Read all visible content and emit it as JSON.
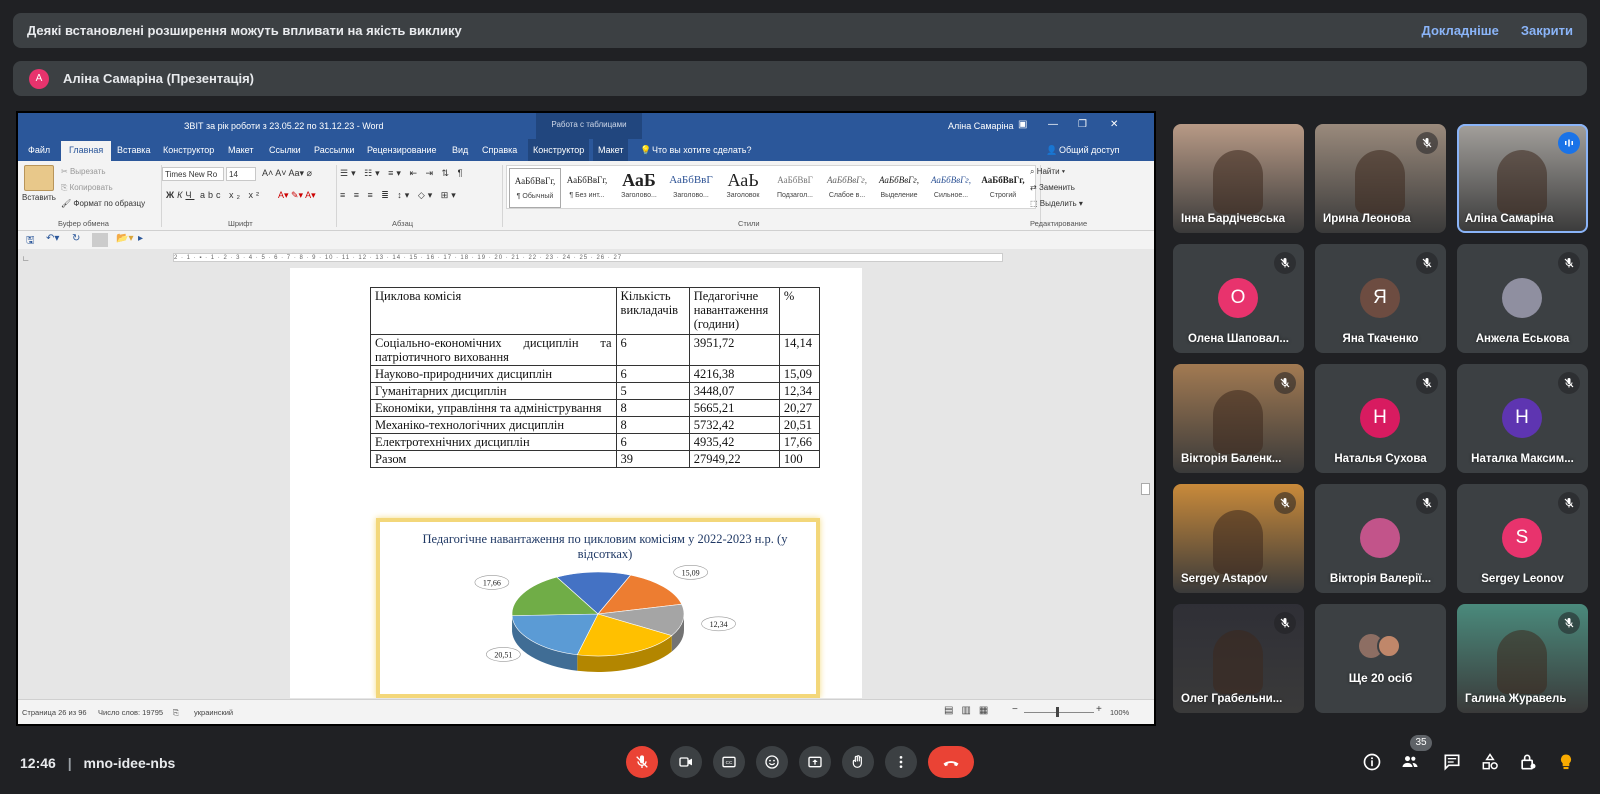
{
  "banner": {
    "text": "Деякі встановлені розширення можуть впливати на якість виклику",
    "more": "Докладніше",
    "close": "Закрити"
  },
  "presenter": {
    "initial": "A",
    "name": "Аліна Самаріна (Презентація)"
  },
  "word": {
    "title": "ЗВІТ за рік роботи з 23.05.22 по 31.12.23  -  Word",
    "table_tools": "Работа с таблицами",
    "user": "Аліна Самаріна",
    "menu": [
      "Файл",
      "Главная",
      "Вставка",
      "Конструктор",
      "Макет",
      "Ссылки",
      "Рассылки",
      "Рецензирование",
      "Вид",
      "Справка",
      "Конструктор",
      "Макет"
    ],
    "tell_me": "Что вы хотите сделать?",
    "share": "Общий доступ",
    "clipboard": {
      "paste": "Вставить",
      "cut": "Вырезать",
      "copy": "Копировать",
      "format": "Формат по образцу",
      "group": "Буфер обмена"
    },
    "font": {
      "name": "Times New Ro",
      "size": "14",
      "group": "Шрифт"
    },
    "paragraph_group": "Абзац",
    "styles": [
      {
        "preview": "АаБбВвГг,",
        "label": "¶ Обычный"
      },
      {
        "preview": "АаБбВвГг,",
        "label": "¶ Без инт..."
      },
      {
        "preview": "АаБ",
        "label": "Заголово..."
      },
      {
        "preview": "АаБбВвГ",
        "label": "Заголово..."
      },
      {
        "preview": "АаЬ",
        "label": "Заголовок"
      },
      {
        "preview": "АаБбВвГ",
        "label": "Подзагол..."
      },
      {
        "preview": "АаБбВвГг,",
        "label": "Слабое в..."
      },
      {
        "preview": "АаБбВвГг,",
        "label": "Выделение"
      },
      {
        "preview": "АаБбВвГг,",
        "label": "Сильное..."
      },
      {
        "preview": "АаБбВвГг,",
        "label": "Строгий"
      }
    ],
    "styles_group": "Стили",
    "editing": {
      "find": "Найти",
      "replace": "Заменить",
      "select": "Выделить",
      "group": "Редактирование"
    },
    "ruler": "2 · 1 · ▪ · 1 · 2 · 3 · 4 · 5 · 6 · 7 · 8 · 9 · 10 · 11 · 12 · 13 · 14 · 15 · 16 · 17 · 18 · 19 · 20 · 21 · 22 · 23 · 24 · 25 · 26 · 27",
    "status": {
      "page": "Страница 26 из 96",
      "words": "Число слов: 19795",
      "lang": "украинский",
      "zoom": "100%"
    }
  },
  "doc_table": {
    "headers": [
      "Циклова комісія",
      "Кількість викладачів",
      "Педагогічне навантаження (години)",
      "%"
    ],
    "rows": [
      [
        "Соціально-економічних дисциплін та патріотичного виховання",
        "6",
        "3951,72",
        "14,14"
      ],
      [
        "Науково-природничих дисциплін",
        "6",
        "4216,38",
        "15,09"
      ],
      [
        "Гуманітарних дисциплін",
        "5",
        "3448,07",
        "12,34"
      ],
      [
        "Економіки, управління та адміністрування",
        "8",
        "5665,21",
        "20,27"
      ],
      [
        "Механіко-технологічних дисциплін",
        "8",
        "5732,42",
        "20,51"
      ],
      [
        "Електротехнічних дисциплін",
        "6",
        "4935,42",
        "17,66"
      ],
      [
        "Разом",
        "39",
        "27949,22",
        "100"
      ]
    ]
  },
  "chart_data": {
    "type": "pie",
    "title": "Педагогічне навантаження по цикловим комісіям у 2022-2023 н.р. (у відсотках)",
    "categories": [
      "Соціально-економічних дисциплін та патріотичного виховання",
      "Науково-природничих дисциплін",
      "Гуманітарних дисциплін",
      "Економіки, управління та адміністрування",
      "Механіко-технологічних дисциплін",
      "Електротехнічних дисциплін"
    ],
    "values": [
      14.14,
      15.09,
      12.34,
      20.27,
      20.51,
      17.66
    ],
    "value_labels": [
      "14,14",
      "15,09",
      "12,34",
      "",
      "20,51",
      "17,66"
    ],
    "colors": [
      "#4472c4",
      "#ed7d31",
      "#a5a5a5",
      "#ffc000",
      "#5b9bd5",
      "#70ad47"
    ]
  },
  "participants": [
    {
      "name": "Інна Бардічевська",
      "kind": "video",
      "muted": false,
      "bg": "#b89a86"
    },
    {
      "name": "Ирина Леонова",
      "kind": "video",
      "muted": true,
      "bg": "#9a8a7c"
    },
    {
      "name": "Аліна Самаріна",
      "kind": "video",
      "muted": false,
      "speaking": true,
      "bg": "#a3a09c"
    },
    {
      "name": "Олена Шаповал...",
      "kind": "avatar",
      "initial": "О",
      "color": "#e8336d",
      "muted": true
    },
    {
      "name": "Яна Ткаченко",
      "kind": "avatar",
      "initial": "Я",
      "color": "#6d4c41",
      "muted": true
    },
    {
      "name": "Анжела Еськова",
      "kind": "photo",
      "color": "#8f8fa0",
      "muted": true
    },
    {
      "name": "Вікторія Баленк...",
      "kind": "video",
      "muted": true,
      "bg": "#a27a52"
    },
    {
      "name": "Наталья Сухова",
      "kind": "avatar",
      "initial": "Н",
      "color": "#d81b60",
      "muted": true
    },
    {
      "name": "Наталка Максим...",
      "kind": "avatar",
      "initial": "Н",
      "color": "#5e35b1",
      "muted": true
    },
    {
      "name": "Sergey Astapov",
      "kind": "video",
      "muted": true,
      "bg": "#c98a3a"
    },
    {
      "name": "Вікторія Валерії...",
      "kind": "photo",
      "color": "#c2548a",
      "muted": true
    },
    {
      "name": "Sergey Leonov",
      "kind": "avatar",
      "initial": "S",
      "color": "#e8336d",
      "muted": true
    },
    {
      "name": "Олег Грабельни...",
      "kind": "video",
      "muted": true,
      "bg": "#2f2f36"
    },
    {
      "name": "Ще 20 осіб",
      "kind": "more"
    },
    {
      "name": "Галина Журавель",
      "kind": "video",
      "muted": true,
      "bg": "#4a8a7c"
    }
  ],
  "bottom": {
    "time": "12:46",
    "meeting_code": "mno-idee-nbs",
    "people_count": "35"
  },
  "colors": {
    "bg": "#202124",
    "tile": "#3c4043",
    "accent": "#8ab4f8",
    "red": "#ea4335",
    "word_blue": "#2b579a"
  }
}
